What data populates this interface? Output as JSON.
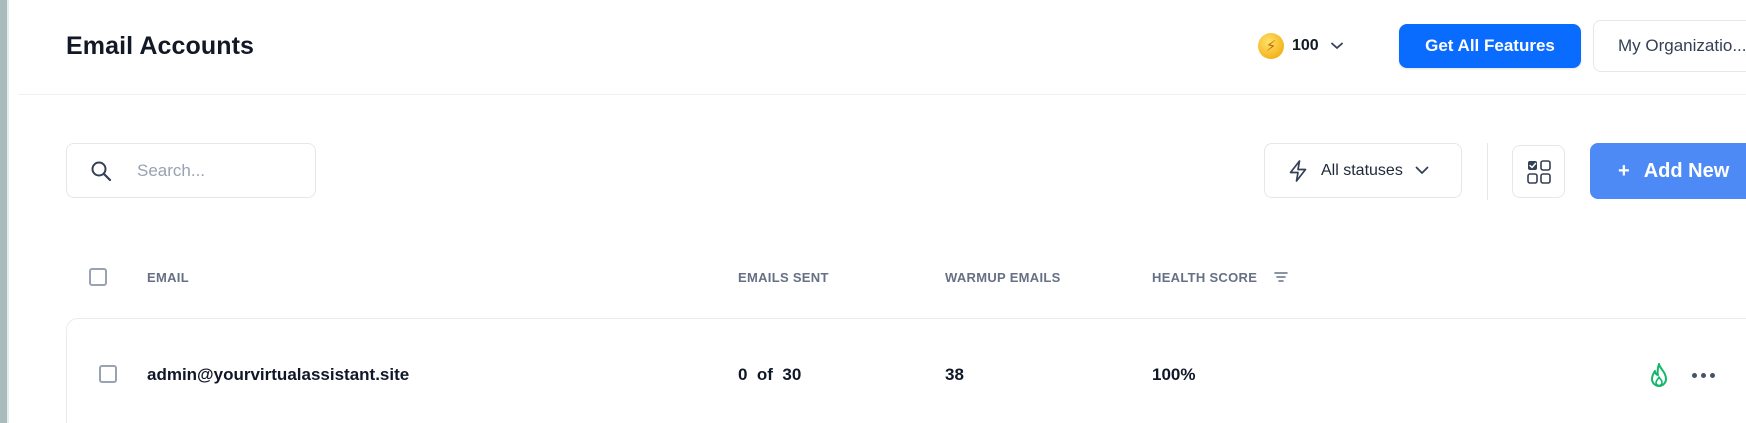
{
  "header": {
    "title": "Email Accounts",
    "credits": "100",
    "credits_icon": "lightning-coin-icon",
    "cta_label": "Get All Features",
    "org_label": "My Organizatio..."
  },
  "toolbar": {
    "search_placeholder": "Search...",
    "status_filter_label": "All statuses",
    "add_label": "Add New",
    "add_icon": "+"
  },
  "table": {
    "columns": [
      "EMAIL",
      "EMAILS SENT",
      "WARMUP EMAILS",
      "HEALTH SCORE"
    ],
    "rows": [
      {
        "email": "admin@yourvirtualassistant.site",
        "emails_sent": "0  of  30",
        "warmup_emails": "38",
        "health_score": "100%"
      }
    ]
  },
  "colors": {
    "primary": "#0a6cff",
    "add_button": "#4d8af5",
    "fire_green": "#12b76a"
  }
}
